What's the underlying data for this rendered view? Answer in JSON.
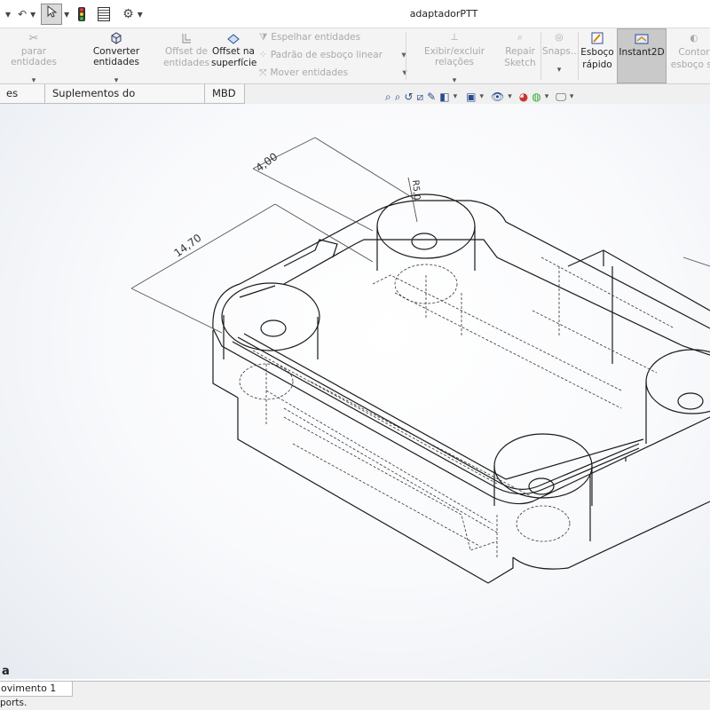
{
  "window": {
    "title": "adaptadorPTT"
  },
  "ribbon": {
    "cut_label": "parar entidades",
    "convert_label": "Converter entidades",
    "offset_entities_line1": "Offset de",
    "offset_entities_line2": "entidades",
    "offset_surface_line1": "Offset na",
    "offset_surface_line2": "superfície",
    "mirror_label": "Espelhar entidades",
    "linear_pattern_label": "Padrão de esboço linear",
    "move_label": "Mover entidades",
    "display_relations_label": "Exibir/excluir relações",
    "repair_line1": "Repair",
    "repair_line2": "Sketch",
    "snaps_label": "Snaps...",
    "quick_sketch_line1": "Esboço",
    "quick_sketch_line2": "rápido",
    "instant2d_label": "Instant2D",
    "contour_line1": "Contor",
    "contour_line2": "esboço so"
  },
  "tabs": [
    "es MBD",
    "Suplementos do SOLIDWORKS",
    "MBD"
  ],
  "dimensions": {
    "d1": "4,00",
    "d2": "14,70",
    "d3": "R5,0"
  },
  "viewport_overlay": {
    "label": "a"
  },
  "bottom_tab": "ovimento 1",
  "status_text": "ports.",
  "colors": {
    "accent_active": "#c9c9c9",
    "model_line": "#1a1a1a"
  }
}
